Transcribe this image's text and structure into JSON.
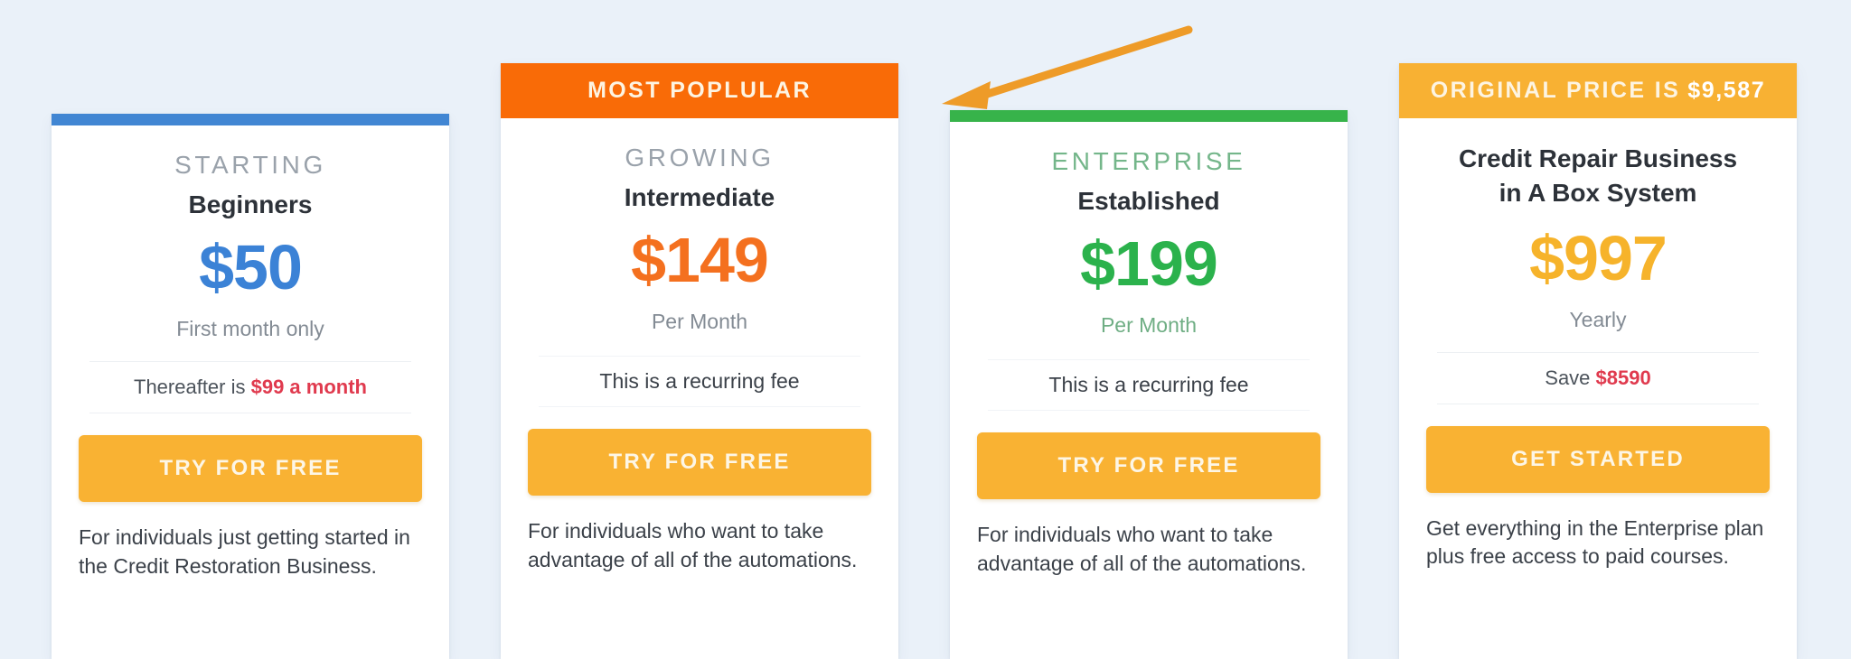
{
  "page": {
    "background_color": "#eaf1f9"
  },
  "annotation": {
    "arrow": {
      "icon": "arrow-left-icon",
      "color": "#ee9b28",
      "points_to": "most-popular-banner"
    }
  },
  "plans": [
    {
      "id": "starting",
      "accent_color": "#4186d3",
      "top_style": "bar",
      "tier_label": "STARTING",
      "tier_name": "Beginners",
      "price": "$50",
      "price_color": "#3b82d6",
      "period": "First month only",
      "note_prefix": "Thereafter is ",
      "note_accent": "$99 a month",
      "note_accent_color": "#e03a4e",
      "cta_label": "TRY FOR FREE",
      "description": "For individuals just getting started in the Credit Restoration Business."
    },
    {
      "id": "growing",
      "accent_color": "#f96b07",
      "top_style": "banner",
      "banner_label": "MOST POPLULAR",
      "tier_label": "GROWING",
      "tier_name": "Intermediate",
      "price": "$149",
      "price_color": "#f4701f",
      "period": "Per Month",
      "note": "This is a recurring fee",
      "cta_label": "TRY FOR FREE",
      "description": "For individuals who want to take advantage of all of the automations."
    },
    {
      "id": "enterprise",
      "accent_color": "#37b34a",
      "top_style": "bar",
      "tier_label": "ENTERPRISE",
      "tier_name": "Established",
      "price": "$199",
      "price_color": "#2bb24c",
      "period": "Per Month",
      "note": "This is a recurring fee",
      "cta_label": "TRY FOR FREE",
      "description": "For individuals who want to take advantage of all of the automations."
    },
    {
      "id": "business-in-a-box",
      "accent_color": "#f8b133",
      "top_style": "banner",
      "banner_label": "ORIGINAL PRICE IS ",
      "banner_value": "$9,587",
      "headline_line1": "Credit Repair Business",
      "headline_line2": "in A Box System",
      "price": "$997",
      "price_color": "#f6b32b",
      "period": "Yearly",
      "note_prefix": "Save ",
      "note_accent": "$8590",
      "note_accent_color": "#e03a4e",
      "cta_label": "GET STARTED",
      "description": "Get everything in the Enterprise plan plus free access to paid courses."
    }
  ]
}
